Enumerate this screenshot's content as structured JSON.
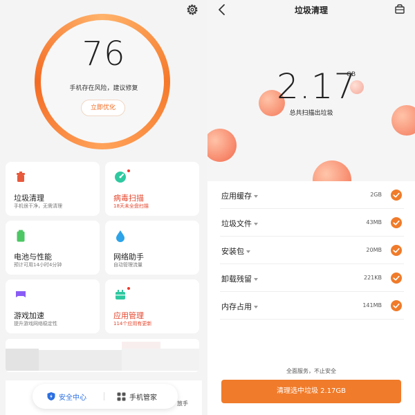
{
  "left": {
    "score": "76",
    "score_desc": "手机存在风险，建议修复",
    "optimize_label": "立即优化",
    "tiles": [
      {
        "title": "垃圾清理",
        "sub": "手机很干净，无需清理"
      },
      {
        "title": "病毒扫描",
        "sub": "18天未全盘扫描"
      },
      {
        "title": "电池与性能",
        "sub": "预计可用14小时4分钟"
      },
      {
        "title": "网络助手",
        "sub": "自动管理流量"
      },
      {
        "title": "游戏加速",
        "sub": "提升游戏网络稳定性"
      },
      {
        "title": "应用管理",
        "sub": "114个应用有更新"
      }
    ],
    "release_text": "放手"
  },
  "bottom_nav": {
    "security_label": "安全中心",
    "manager_label": "手机管家"
  },
  "right": {
    "title": "垃圾清理",
    "junk_size": "2.17",
    "junk_unit": "GB",
    "junk_label": "总共扫描出垃圾",
    "items": [
      {
        "label": "应用缓存",
        "size": "2GB",
        "checked": true
      },
      {
        "label": "垃圾文件",
        "size": "43MB",
        "checked": true
      },
      {
        "label": "安装包",
        "size": "20MB",
        "checked": true
      },
      {
        "label": "卸载残留",
        "size": "221KB",
        "checked": true
      },
      {
        "label": "内存占用",
        "size": "141MB",
        "checked": true
      }
    ],
    "service_note": "全面服务，不止安全",
    "clean_button": "清理选中垃圾 2.17GB"
  },
  "colors": {
    "accent_orange": "#f07b2a",
    "warning_red": "#e5462d",
    "security_blue": "#2b6fe0"
  },
  "icons": [
    "gear-icon",
    "trash-icon",
    "virus-scan-icon",
    "battery-icon",
    "network-drop-icon",
    "gamepad-icon",
    "app-manager-icon",
    "shield-icon",
    "grid-apps-icon",
    "back-arrow-icon",
    "bag-icon",
    "check-icon",
    "caret-down-icon"
  ]
}
